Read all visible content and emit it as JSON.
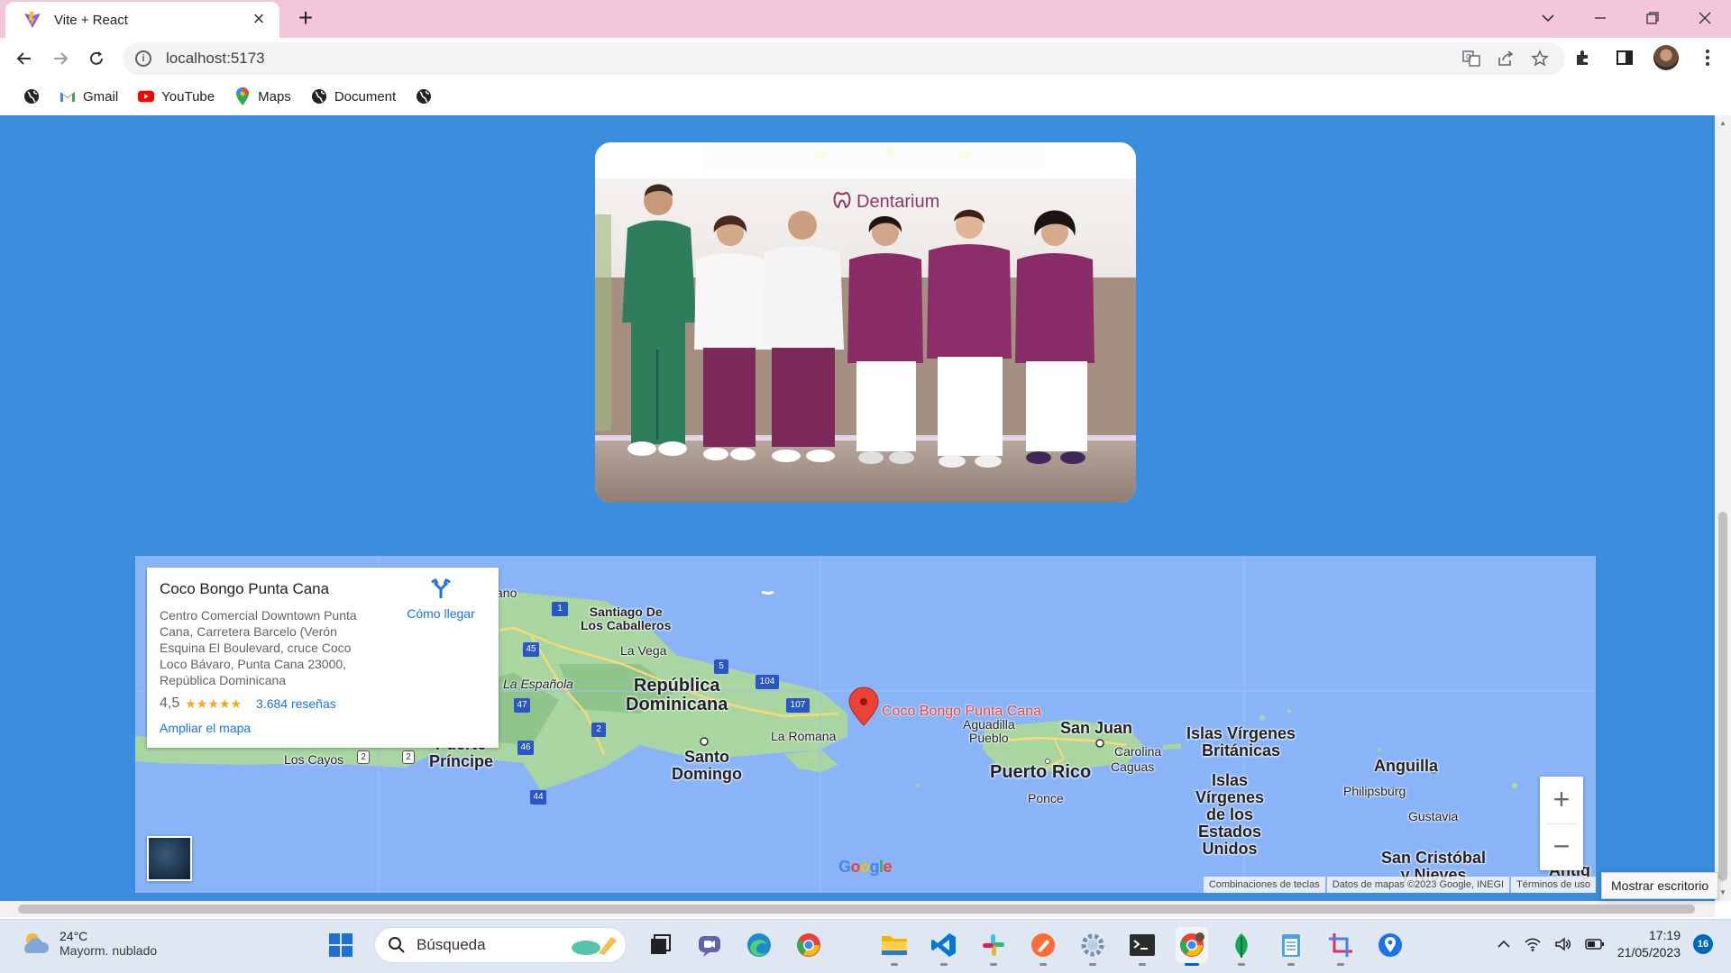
{
  "browser": {
    "tab_title": "Vite + React",
    "url": "localhost:5173",
    "bookmarks": [
      {
        "label": "",
        "icon": "globe-icon"
      },
      {
        "label": "Gmail",
        "icon": "gmail-icon"
      },
      {
        "label": "YouTube",
        "icon": "youtube-icon"
      },
      {
        "label": "Maps",
        "icon": "maps-icon"
      },
      {
        "label": "Document",
        "icon": "globe-icon"
      },
      {
        "label": "",
        "icon": "globe-icon"
      }
    ]
  },
  "page": {
    "background_color": "#3b8ddd",
    "photo": {
      "sign_text": "Dentarium"
    }
  },
  "map": {
    "place_title": "Coco Bongo Punta Cana",
    "address": "Centro Comercial Downtown Punta Cana, Carretera Barcelo (Verón Esquina El Boulevard, cruce Coco Loco Bávaro, Punta Cana 23000, República Dominicana",
    "rating": "4,5",
    "stars": "★★★★★",
    "reviews": "3.684 reseñas",
    "directions_label": "Cómo llegar",
    "enlarge_label": "Ampliar el mapa",
    "pin_label": "Coco Bongo Punta Cana",
    "labels": {
      "santiago": "Santiago De\nLos Caballeros",
      "la_vega": "La Vega",
      "la_espanola": "La Española",
      "rep_dom": "República\nDominicana",
      "la_romana": "La Romana",
      "santo_domingo": "Santo\nDomingo",
      "los_cayos": "Los Cayos",
      "port_au_prince": "Puerto\nPríncipe",
      "aguadilla": "Aguadilla\nPueblo",
      "san_juan": "San Juan",
      "carolina": "Carolina",
      "caguas": "Caguas",
      "puerto_rico": "Puerto Rico",
      "ponce": "Ponce",
      "bvi": "Islas Vírgenes\nBritánicas",
      "usvi": "Islas\nVírgenes\nde los\nEstados\nUnidos",
      "anguilla": "Anguilla",
      "philipsburg": "Philipsburg",
      "gustavia": "Gustavia",
      "san_cristobal": "San Cristóbal\ny Nieves",
      "antigua": "Antig",
      "partial_ano": "ano"
    },
    "shields": [
      "1",
      "45",
      "5",
      "104",
      "47",
      "107",
      "2",
      "46",
      "44",
      "2",
      "2"
    ],
    "footer": [
      "Combinaciones de teclas",
      "Datos de mapas ©2023 Google, INEGI",
      "Términos de uso"
    ],
    "google_logo": "Google"
  },
  "tooltip": "Mostrar escritorio",
  "taskbar": {
    "temperature": "24°C",
    "weather_desc": "Mayorm. nublado",
    "search_placeholder": "Búsqueda",
    "time": "17:19",
    "date": "21/05/2023",
    "notifications": "16"
  }
}
